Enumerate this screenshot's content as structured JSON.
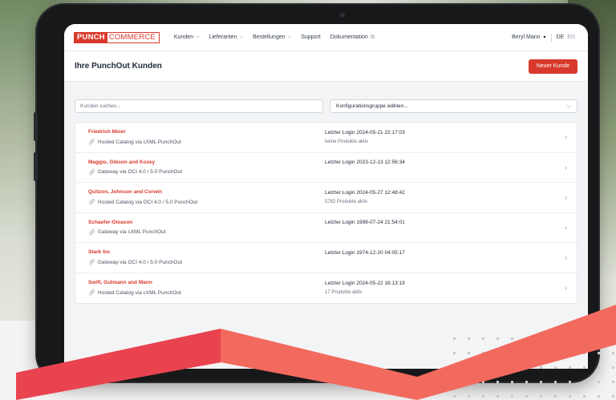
{
  "brand": {
    "part1": "PUNCH",
    "part2": "COMMERCE"
  },
  "nav": {
    "items": [
      {
        "label": "Kunden",
        "dropdown": true
      },
      {
        "label": "Lieferanten",
        "dropdown": true
      },
      {
        "label": "Bestellungen",
        "dropdown": true
      },
      {
        "label": "Support",
        "dropdown": false
      },
      {
        "label": "Dokumentation",
        "external": true
      }
    ],
    "user": "Beryl Mann",
    "languages": [
      "DE",
      "EN"
    ],
    "active_language": "DE"
  },
  "header": {
    "title": "Ihre PunchOut Kunden",
    "new_button": "Neuer Kunde"
  },
  "filters": {
    "search_placeholder": "Kunden suchen...",
    "group_select": "Konfigurationsgruppe wählen..."
  },
  "customers": [
    {
      "name": "Friedrich Meier",
      "type": "Hosted Catalog via cXML PunchOut",
      "last_login": "Letzter Login 2024-05-21 22:17:03",
      "products": "keine Produkte aktiv"
    },
    {
      "name": "Maggio, Gibson and Kozey",
      "type": "Gateway via OCI 4.0 / 5.0 PunchOut",
      "last_login": "Letzter Login 2023-12-13 12:56:34",
      "products": ""
    },
    {
      "name": "Quitzon, Johnson and Corwin",
      "type": "Hosted Catalog via OCI 4.0 / 5.0 PunchOut",
      "last_login": "Letzter Login 2024-05-27 12:48:42",
      "products": "5782 Produkte aktiv"
    },
    {
      "name": "Schaefer-Gleason",
      "type": "Gateway via cXML PunchOut",
      "last_login": "Letzter Login 1998-07-24 21:54:01",
      "products": ""
    },
    {
      "name": "Stark Inc",
      "type": "Gateway via OCI 4.0 / 5.0 PunchOut",
      "last_login": "Letzter Login 1974-12-20 04:05:17",
      "products": ""
    },
    {
      "name": "Swift, Gutmann and Mann",
      "type": "Hosted Catalog via cXML PunchOut",
      "last_login": "Letzter Login 2024-05-22 16:13:19",
      "products": "17 Produkte aktiv"
    }
  ],
  "colors": {
    "accent": "#d8392c",
    "stripe": "#f26a5e"
  },
  "icons": {
    "caret": "chevron-down-icon",
    "external": "external-link-icon",
    "link": "link-icon",
    "row_chevron": "chevron-right-icon"
  }
}
